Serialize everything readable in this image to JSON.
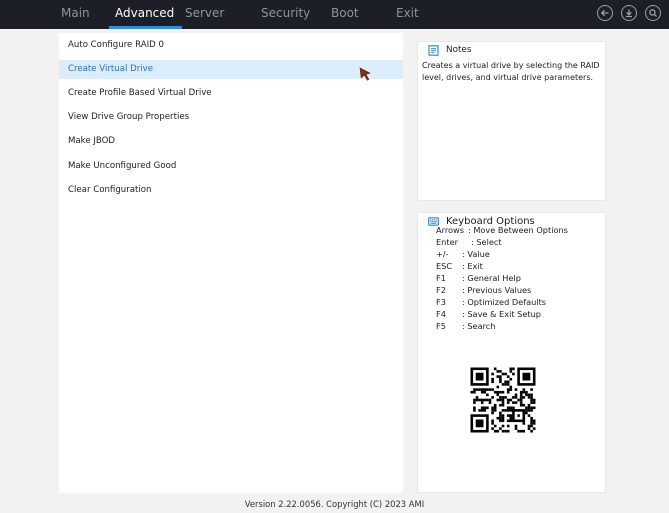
{
  "tabs": [
    {
      "label": "Main",
      "active": false
    },
    {
      "label": "Advanced",
      "active": true
    },
    {
      "label": "Server",
      "active": false
    },
    {
      "label": "Security",
      "active": false
    },
    {
      "label": "Boot",
      "active": false
    },
    {
      "label": "Exit",
      "active": false
    }
  ],
  "top_icons": [
    "back-icon",
    "download-icon",
    "search-icon"
  ],
  "menu": {
    "items": [
      {
        "label": "Auto Configure RAID 0",
        "selected": false
      },
      {
        "label": "Create Virtual Drive",
        "selected": true
      },
      {
        "label": "Create Profile Based Virtual Drive",
        "selected": false
      },
      {
        "label": "View Drive Group Properties",
        "selected": false
      },
      {
        "label": "Make JBOD",
        "selected": false
      },
      {
        "label": "Make Unconfigured Good",
        "selected": false
      },
      {
        "label": "Clear Configuration",
        "selected": false
      }
    ]
  },
  "notes": {
    "title": "Notes",
    "text": "Creates a virtual drive by selecting the RAID level, drives, and virtual drive parameters."
  },
  "keyboard": {
    "title": "Keyboard Options",
    "options": [
      {
        "key": "Arrows",
        "desc": ": Move Between Options"
      },
      {
        "key": "Enter",
        "desc": ": Select"
      },
      {
        "key": "+/-",
        "desc": ": Value"
      },
      {
        "key": "ESC",
        "desc": ": Exit"
      },
      {
        "key": "F1",
        "desc": ": General Help"
      },
      {
        "key": "F2",
        "desc": ": Previous Values"
      },
      {
        "key": "F3",
        "desc": ": Optimized Defaults"
      },
      {
        "key": "F4",
        "desc": ": Save & Exit Setup"
      },
      {
        "key": "F5",
        "desc": ": Search"
      }
    ]
  },
  "footer": {
    "version": "Version 2.22.0056. Copyright (C) 2023 AMI"
  },
  "colors": {
    "topbar": "#1c1f27",
    "accent": "#2f8ae0",
    "selected_bg": "#dbecfa",
    "selected_text": "#2b72c6",
    "cursor": "#8b2a12"
  }
}
